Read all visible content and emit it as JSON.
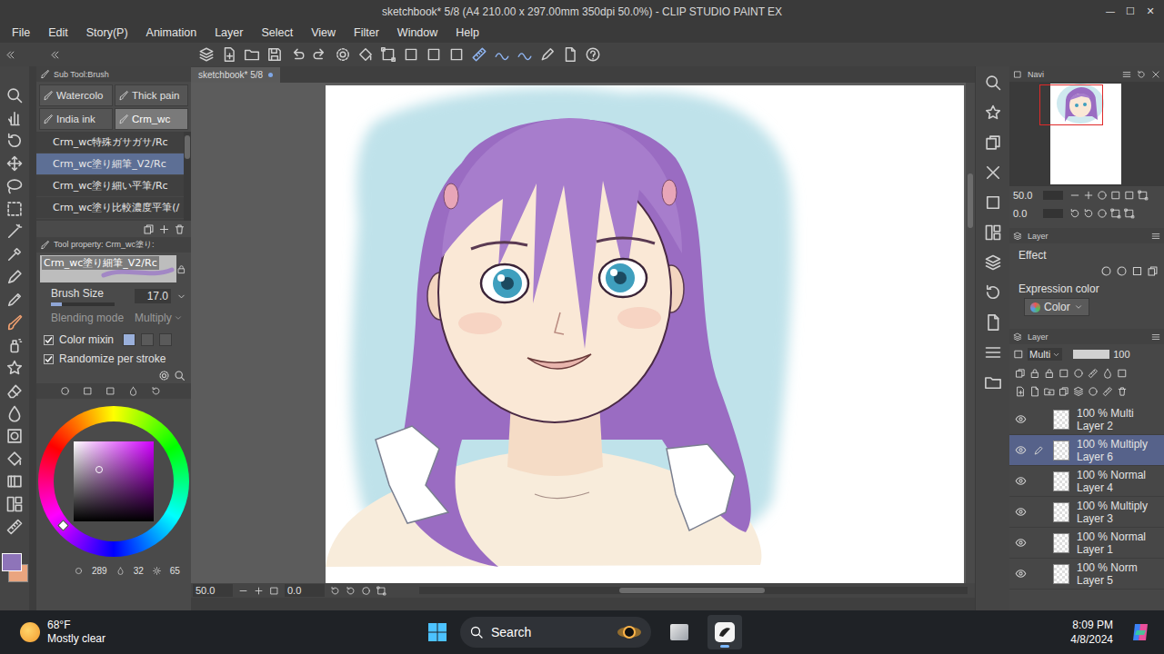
{
  "window": {
    "title": "sketchbook* 5/8 (A4 210.00 x 297.00mm 350dpi 50.0%) - CLIP STUDIO PAINT EX",
    "controls": [
      "—",
      "☐",
      "✕"
    ]
  },
  "menu": [
    "File",
    "Edit",
    "Story(P)",
    "Animation",
    "Layer",
    "Select",
    "View",
    "Filter",
    "Window",
    "Help"
  ],
  "sub_tool": {
    "title": "Sub Tool:Brush",
    "groups": [
      {
        "label": "Watercolo",
        "selected": false
      },
      {
        "label": "Thick pain",
        "selected": false
      },
      {
        "label": "India ink",
        "selected": false
      },
      {
        "label": "Crm_wc",
        "selected": true
      }
    ],
    "brushes": [
      {
        "label": "Crm_wc特殊ガサガサ/Rc",
        "selected": false
      },
      {
        "label": "Crm_wc塗り細筆_V2/Rc",
        "selected": true
      },
      {
        "label": "Crm_wc塗り細い平筆/Rc",
        "selected": false
      },
      {
        "label": "Crm_wc塗り比較濃度平筆(/",
        "selected": false
      }
    ]
  },
  "tool_property": {
    "title": "Tool property: Crm_wc塗り:",
    "brush": "Crm_wc塗り細筆_V2/Rc",
    "brush_size": {
      "label": "Brush Size",
      "value": "17.0",
      "level": 0.17
    },
    "blending": {
      "label": "Blending mode",
      "value": "Multiply",
      "disabled": true
    },
    "color_mixing": {
      "label": "Color mixin",
      "checked": true,
      "modes": [
        {
          "selected": true
        },
        {
          "selected": false
        },
        {
          "selected": false
        }
      ]
    },
    "randomize": {
      "label": "Randomize per stroke",
      "checked": true
    }
  },
  "color_wheel": {
    "hue": 0.803,
    "saturation": 0.32,
    "brightness": 0.65,
    "readouts": [
      "289",
      "32",
      "65"
    ]
  },
  "swatches": [
    {
      "color": "#8e74b9",
      "selected": true
    },
    {
      "color": "#eaa57f",
      "selected": false
    }
  ],
  "document_tab": {
    "label": "sketchbook* 5/8",
    "selected": true
  },
  "canvas_status": {
    "zoom": "50.0",
    "angle": "0.0"
  },
  "navigator": {
    "title": "Navi",
    "zoom": "50.0",
    "angle": "0.0"
  },
  "layer_property": {
    "title": "Layer",
    "effect": "Effect",
    "expression_label": "Expression color",
    "expression_value": "Color"
  },
  "layers": {
    "title": "Layer",
    "blend": "Multi",
    "opacity": "100",
    "opacity_level": 1,
    "items": [
      {
        "mode": "100 % Multi",
        "name": "Layer 2",
        "visible": true,
        "selected": false
      },
      {
        "mode": "100 % Multiply",
        "name": "Layer 6",
        "visible": true,
        "selected": true
      },
      {
        "mode": "100 % Normal",
        "name": "Layer 4",
        "visible": true,
        "selected": false
      },
      {
        "mode": "100 % Multiply",
        "name": "Layer 3",
        "visible": true,
        "selected": false
      },
      {
        "mode": "100 % Normal",
        "name": "Layer 1",
        "visible": true,
        "selected": false
      },
      {
        "mode": "100 % Norm",
        "name": "Layer 5",
        "visible": true,
        "selected": false
      }
    ]
  },
  "taskbar": {
    "temp": "68°F",
    "weather": "Mostly clear",
    "search": "Search",
    "time": "8:09 PM",
    "date": "4/8/2024"
  }
}
